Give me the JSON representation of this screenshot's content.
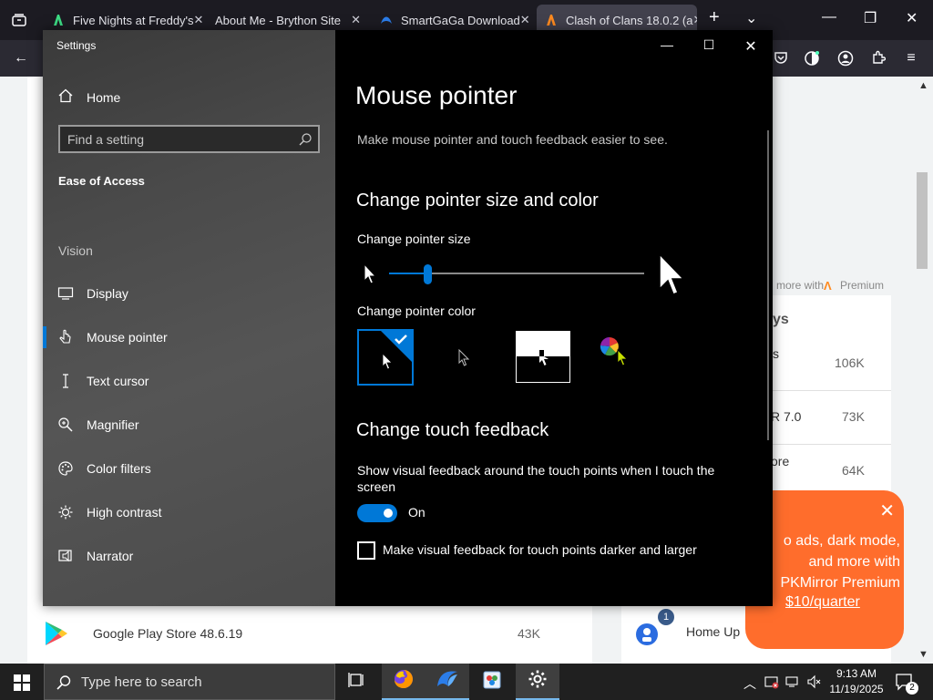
{
  "browser": {
    "tabs": [
      {
        "label": "Five Nights at Freddy's",
        "favicon": "apkmirror-icon"
      },
      {
        "label": "About Me - Brython Site",
        "favicon": ""
      },
      {
        "label": "SmartGaGa Download",
        "favicon": "smartgaga-icon"
      },
      {
        "label": "Clash of Clans 18.0.2 (a",
        "favicon": "apkmirror-icon"
      }
    ]
  },
  "webpage": {
    "premium_text": "more with",
    "premium_brand": "Premium",
    "section_heading_fragment": "ys",
    "rows_right": [
      {
        "text": "s",
        "count": "106K"
      },
      {
        "text": "R 7.0",
        "count": "73K"
      },
      {
        "text": "ore",
        "count": "64K"
      }
    ],
    "bottom_row": {
      "title": "Google Play Store 48.6.19",
      "count": "43K"
    },
    "homeup": {
      "label": "Home Up",
      "badge": "1"
    },
    "promo": {
      "text": "o ads, dark mode, and more with PKMirror Premium",
      "link": "$10/quarter"
    }
  },
  "settings": {
    "window_title": "Settings",
    "nav": {
      "home_label": "Home",
      "search_placeholder": "Find a setting",
      "section_title": "Ease of Access",
      "group_label": "Vision",
      "items": [
        {
          "label": "Display",
          "icon": "display-icon"
        },
        {
          "label": "Mouse pointer",
          "icon": "mouse-pointer-icon"
        },
        {
          "label": "Text cursor",
          "icon": "text-cursor-icon"
        },
        {
          "label": "Magnifier",
          "icon": "magnifier-icon"
        },
        {
          "label": "Color filters",
          "icon": "color-filters-icon"
        },
        {
          "label": "High contrast",
          "icon": "high-contrast-icon"
        },
        {
          "label": "Narrator",
          "icon": "narrator-icon"
        }
      ],
      "selected_item": "Mouse pointer"
    },
    "content": {
      "title": "Mouse pointer",
      "description": "Make mouse pointer and touch feedback easier to see.",
      "section_size_color": "Change pointer size and color",
      "size_label": "Change pointer size",
      "size_value": 0.15,
      "color_label": "Change pointer color",
      "color_options": [
        "white",
        "black",
        "inverted",
        "custom"
      ],
      "selected_color": "white",
      "section_touch": "Change touch feedback",
      "touch_desc": "Show visual feedback around the touch points when I touch the screen",
      "toggle_state": "On",
      "checkbox_label": "Make visual feedback for touch points darker and larger",
      "checkbox_checked": false
    }
  },
  "taskbar": {
    "search_placeholder": "Type here to search",
    "time": "9:13 AM",
    "date": "11/19/2025",
    "notification_count": "2",
    "accent": "#76b9ed"
  },
  "colors": {
    "accent": "#0078d7",
    "promo": "#ff6d2c"
  }
}
